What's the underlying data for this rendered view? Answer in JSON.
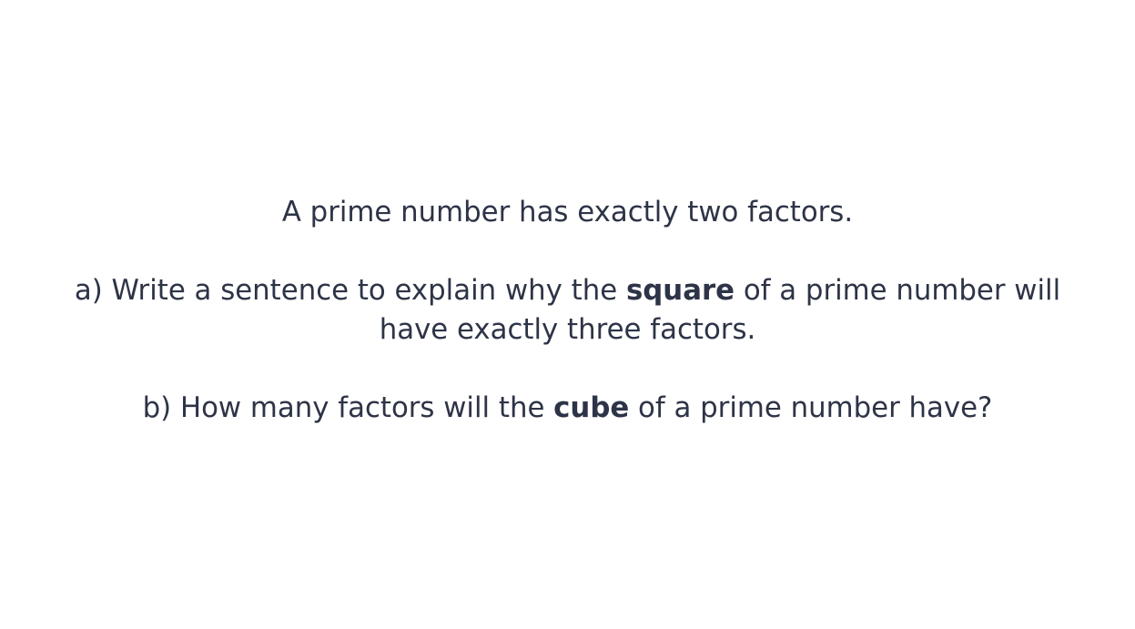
{
  "slide": {
    "intro": "A prime number has exactly two factors.",
    "question_a": {
      "line1_before": "a) Write a sentence to explain why the ",
      "line1_bold": "square",
      "line1_after": " of a prime number will",
      "line2": "have exactly three factors."
    },
    "question_b": {
      "before": "b) How many factors will the ",
      "bold": "cube",
      "after": " of a prime number have?"
    }
  }
}
